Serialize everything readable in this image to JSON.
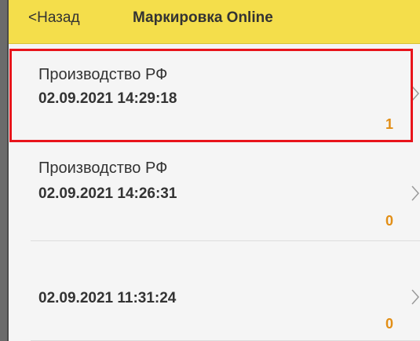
{
  "header": {
    "back_label": "<Назад",
    "title": "Маркировка Online",
    "background_color": "#f4de4b"
  },
  "list": {
    "items": [
      {
        "label": "Производство РФ",
        "date": "02.09.2021 14:29:18",
        "count": "1",
        "highlighted": true
      },
      {
        "label": "Производство РФ",
        "date": "02.09.2021 14:26:31",
        "count": "0",
        "highlighted": false
      },
      {
        "label": "",
        "date": "02.09.2021 11:31:24",
        "count": "0",
        "highlighted": false
      }
    ],
    "chevron_icon": "chevron-right-icon",
    "count_color": "#e28e15",
    "highlight_color": "#e8141b"
  }
}
